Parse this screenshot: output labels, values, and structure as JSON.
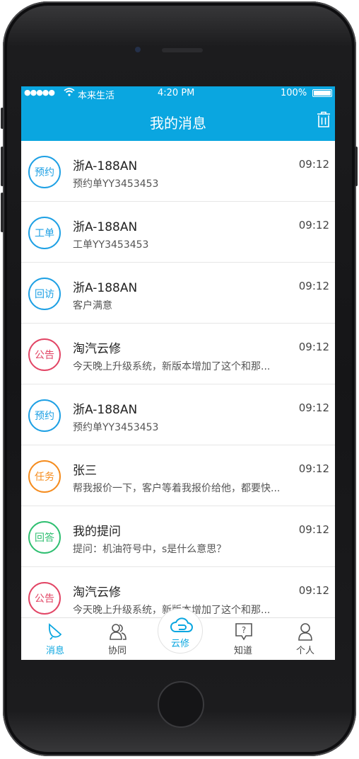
{
  "status_bar": {
    "signal": "●●●●●",
    "carrier": "本来生活",
    "time": "4:20 PM",
    "battery": "100%"
  },
  "header": {
    "title": "我的消息",
    "trash_icon": "trash-icon"
  },
  "colors": {
    "accent": "#0aa6e0",
    "blue": "#1ea0e4",
    "red": "#e24565",
    "orange": "#f58c1e",
    "green": "#2fbf71"
  },
  "messages": [
    {
      "badge": "预约",
      "name": "浙A-188AN",
      "time": "09:12",
      "sub": "预约单YY3453453"
    },
    {
      "badge": "工单",
      "name": "浙A-188AN",
      "time": "09:12",
      "sub": "工单YY3453453"
    },
    {
      "badge": "回访",
      "name": "浙A-188AN",
      "time": "09:12",
      "sub": "客户满意"
    },
    {
      "badge": "公告",
      "name": "淘汽云修",
      "time": "09:12",
      "sub": "今天晚上升级系统，新版本增加了这个和那..."
    },
    {
      "badge": "预约",
      "name": "浙A-188AN",
      "time": "09:12",
      "sub": "预约单YY3453453"
    },
    {
      "badge": "任务",
      "name": "张三",
      "time": "09:12",
      "sub": "帮我报价一下，客户等着我报价给他，都要快..."
    },
    {
      "badge": "回答",
      "name": "我的提问",
      "time": "09:12",
      "sub": "提问：机油符号中，s是什么意思？"
    },
    {
      "badge": "公告",
      "name": "淘汽云修",
      "time": "09:12",
      "sub": "今天晚上升级系统，新版本增加了这个和那..."
    }
  ],
  "tabs": {
    "messages": "消息",
    "collab": "协同",
    "cloud": "云修",
    "knowledge": "知道",
    "profile": "个人"
  }
}
